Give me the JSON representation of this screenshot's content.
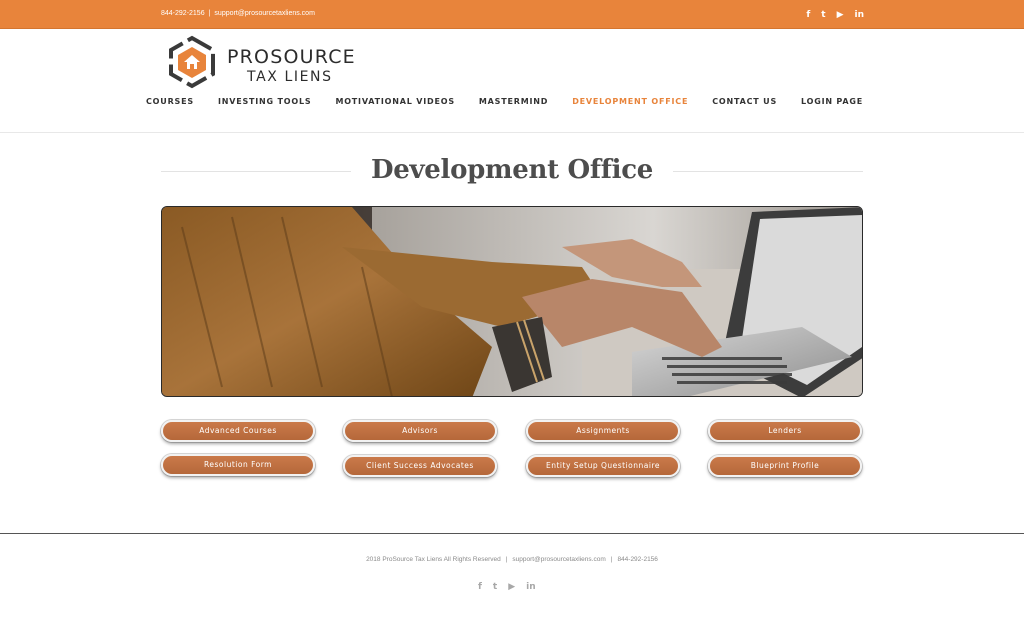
{
  "topbar": {
    "phone": "844-292-2156",
    "separator": "|",
    "email": "support@prosourcetaxliens.com",
    "social": [
      {
        "icon": "facebook-icon",
        "glyph": "f"
      },
      {
        "icon": "twitter-icon",
        "glyph": "t"
      },
      {
        "icon": "youtube-icon",
        "glyph": "▶"
      },
      {
        "icon": "linkedin-icon",
        "glyph": "in"
      }
    ]
  },
  "logo": {
    "line1": "PROSOURCE",
    "line2": "TAX LIENS"
  },
  "nav": {
    "items": [
      {
        "label": "COURSES"
      },
      {
        "label": "INVESTING TOOLS"
      },
      {
        "label": "MOTIVATIONAL VIDEOS"
      },
      {
        "label": "MASTERMIND"
      },
      {
        "label": "DEVELOPMENT OFFICE"
      },
      {
        "label": "CONTACT US"
      },
      {
        "label": "LOGIN PAGE"
      }
    ],
    "active_index": 4
  },
  "page": {
    "title": "Development Office"
  },
  "buttons": [
    {
      "label": "Advanced Courses"
    },
    {
      "label": "Advisors"
    },
    {
      "label": "Assignments"
    },
    {
      "label": "Lenders"
    },
    {
      "label": "Resolution Form"
    },
    {
      "label": "Client Success Advocates"
    },
    {
      "label": "Entity Setup Questionnaire"
    },
    {
      "label": "Blueprint Profile"
    }
  ],
  "footer": {
    "copyright": "2018 ProSource Tax Liens All Rights Reserved",
    "separator": "|",
    "email": "support@prosourcetaxliens.com",
    "phone": "844-292-2156",
    "social": [
      {
        "icon": "facebook-icon",
        "glyph": "f"
      },
      {
        "icon": "twitter-icon",
        "glyph": "t"
      },
      {
        "icon": "youtube-icon",
        "glyph": "▶"
      },
      {
        "icon": "linkedin-icon",
        "glyph": "in"
      }
    ]
  },
  "colors": {
    "accent": "#e8843b",
    "button": "#c07040",
    "title": "#4d4d4d"
  }
}
